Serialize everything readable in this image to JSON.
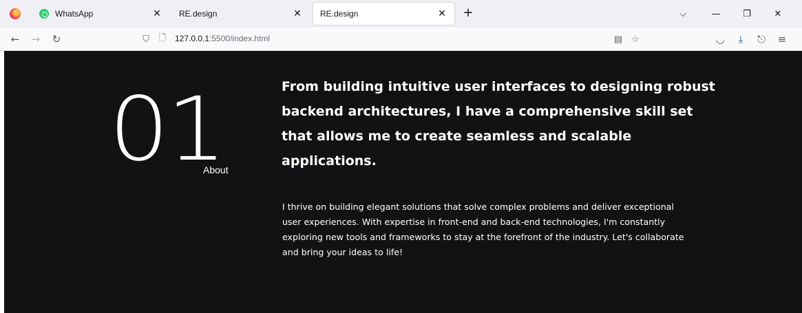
{
  "browser": {
    "tabs": [
      {
        "title": "WhatsApp",
        "icon": "whatsapp-icon"
      },
      {
        "title": "RE.design",
        "icon": "none"
      },
      {
        "title": "RE.design",
        "icon": "none",
        "active": true
      }
    ],
    "url": {
      "host": "127.0.0.1",
      "rest": ":5500/index.html"
    },
    "icons": {
      "browser_logo": "firefox-icon",
      "tab_close": "close-icon",
      "new_tab": "plus-icon",
      "tab_list": "chevron-down-icon",
      "minimize": "minimize-icon",
      "restore": "restore-icon",
      "close_window": "close-icon",
      "back": "back-arrow-icon",
      "forward": "forward-arrow-icon",
      "reload": "reload-icon",
      "tracking_shield": "shield-icon",
      "page_info": "page-icon",
      "reader_view": "reader-view-icon",
      "bookmark": "star-icon",
      "pocket": "pocket-icon",
      "downloads": "download-icon",
      "share": "share-icon",
      "menu": "hamburger-menu-icon"
    },
    "glyphs": {
      "close": "✕",
      "plus": "+",
      "chevron": "⌵",
      "minimize": "—",
      "restore": "❐",
      "back": "←",
      "forward": "→",
      "reload": "↻",
      "shield": "⛉",
      "page": "🗋",
      "reader": "▤",
      "star": "☆",
      "pocket": "◡",
      "download": "⤓",
      "share": "⎋",
      "menu": "≡"
    },
    "colors": {
      "download_accent": "#0060df"
    }
  },
  "page": {
    "number": "01",
    "label": "About",
    "headline": "From building intuitive user interfaces to designing robust backend architectures, I have a comprehensive skill set that allows me to create seamless and scalable applications.",
    "paragraph": "I thrive on building elegant solutions that solve complex problems and deliver exceptional user experiences. With expertise in front-end and back-end technologies, I'm constantly exploring new tools and frameworks to stay at the forefront of the industry. Let's collaborate and bring your ideas to life!",
    "colors": {
      "background": "#121214",
      "text": "#ffffff"
    }
  }
}
